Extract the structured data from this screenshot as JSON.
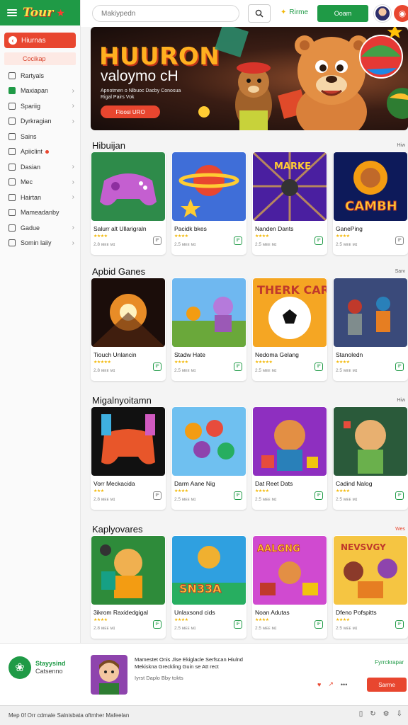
{
  "brand": {
    "logo": "Tour"
  },
  "sidebar": {
    "active": "Hiurnas",
    "sub": "Cocikap",
    "items": [
      {
        "label": "Rartyals",
        "chevron": false,
        "green": false,
        "dot": false
      },
      {
        "label": "Maxiapan",
        "chevron": true,
        "green": true,
        "dot": false
      },
      {
        "label": "Spariig",
        "chevron": true,
        "green": false,
        "dot": false
      },
      {
        "label": "Dyrkragian",
        "chevron": true,
        "green": false,
        "dot": false
      },
      {
        "label": "Sains",
        "chevron": false,
        "green": false,
        "dot": false
      },
      {
        "label": "Apiiclint",
        "chevron": false,
        "green": false,
        "dot": true
      },
      {
        "label": "Dasian",
        "chevron": true,
        "green": false,
        "dot": false
      },
      {
        "label": "Mec",
        "chevron": true,
        "green": false,
        "dot": false
      },
      {
        "label": "Hairtan",
        "chevron": true,
        "green": false,
        "dot": false
      },
      {
        "label": "Mameadanby",
        "chevron": false,
        "green": false,
        "dot": false
      },
      {
        "label": "Gadue",
        "chevron": true,
        "green": false,
        "dot": false
      },
      {
        "label": "Somin laiiy",
        "chevron": true,
        "green": false,
        "dot": false
      }
    ]
  },
  "header": {
    "search_placeholder": "Makiypedn",
    "promo": "Rirme",
    "cta": "Ooam"
  },
  "hero": {
    "title": "HUURON",
    "subtitle": "valoymo cH",
    "desc": "Apnotmen o Nlbuoc Dacby Conosua Rigal Pairs Vok",
    "button": "Floosi URO"
  },
  "sections": [
    {
      "title": "Hibuijan",
      "more": "Hiw",
      "more_red": false,
      "cards": [
        {
          "title": "Salurr alt Ullarigraln",
          "stars": "★★★★",
          "meta": "2.8 ᴍᴇᴇ ᴍɪ",
          "badge": "IF",
          "badge_gray": true
        },
        {
          "title": "Pacidk bkes",
          "stars": "★★★★",
          "meta": "2.5 ᴍᴇᴇ ᴍɪ",
          "badge": "IF",
          "badge_gray": false
        },
        {
          "title": "Nanden Dants",
          "stars": "★★★★",
          "meta": "2.5 ᴍᴇᴇ ᴍɪ",
          "badge": "IF",
          "badge_gray": false
        },
        {
          "title": "GanePing",
          "stars": "★★★★",
          "meta": "2.5 ᴍᴇᴇ ᴍɪ",
          "badge": "IF",
          "badge_gray": true
        }
      ]
    },
    {
      "title": "Apbid Ganes",
      "more": "Sarv",
      "more_red": false,
      "cards": [
        {
          "title": "Tiouch Unlancin",
          "stars": "★★★★★",
          "meta": "2.8 ᴍᴇᴇ ᴍɪ",
          "badge": "IF",
          "badge_gray": false
        },
        {
          "title": "Stadw Hate",
          "stars": "★★★★",
          "meta": "2.5 ᴍᴇᴇ ᴍɪ",
          "badge": "IF",
          "badge_gray": false
        },
        {
          "title": "Nedoma Gelang",
          "stars": "★★★★★",
          "meta": "2.5 ᴍᴇᴇ ᴍɪ",
          "badge": "IF",
          "badge_gray": false
        },
        {
          "title": "Stanoledn",
          "stars": "★★★★",
          "meta": "2.5 ᴍᴇᴇ ᴍɪ",
          "badge": "IF",
          "badge_gray": false
        }
      ]
    },
    {
      "title": "Migalnyoitamn",
      "more": "Hiw",
      "more_red": false,
      "cards": [
        {
          "title": "Vorr Meckacida",
          "stars": "★★★",
          "meta": "2.8 ᴍᴇᴇ ᴍɪ",
          "badge": "IF",
          "badge_gray": true
        },
        {
          "title": "Darm Aane Nig",
          "stars": "★★★★",
          "meta": "2.5 ᴍᴇᴇ ᴍɪ",
          "badge": "IF",
          "badge_gray": false
        },
        {
          "title": "Dat Reet Dats",
          "stars": "★★★★",
          "meta": "2.5 ᴍᴇᴇ ᴍɪ",
          "badge": "IF",
          "badge_gray": false
        },
        {
          "title": "Cadind Nalog",
          "stars": "★★★★",
          "meta": "2.5 ᴍᴇᴇ ᴍɪ",
          "badge": "IF",
          "badge_gray": false
        }
      ]
    },
    {
      "title": "Kaplyovares",
      "more": "Wes",
      "more_red": true,
      "cards": [
        {
          "title": "3ikrom Raxidedgigal",
          "stars": "★★★★",
          "meta": "2.8 ᴍᴇᴇ ᴍɪ",
          "badge": "IF",
          "badge_gray": false
        },
        {
          "title": "Unlaxsond cids",
          "stars": "★★★★",
          "meta": "2.5 ᴍᴇᴇ ᴍɪ",
          "badge": "IF",
          "badge_gray": false
        },
        {
          "title": "Noan Adutas",
          "stars": "★★★★",
          "meta": "2.5 ᴍᴇᴇ ᴍɪ",
          "badge": "IF",
          "badge_gray": false
        },
        {
          "title": "Dfeno Pofspitts",
          "stars": "★★★★",
          "meta": "2.5 ᴍᴇᴇ ᴍɪ",
          "badge": "IF",
          "badge_gray": false
        }
      ]
    }
  ],
  "footer": {
    "brand_title": "Stayysind",
    "brand_sub": "Catsenno",
    "text": "Mamestet Onis Jlse Ekiglacle Serfscan Hiulnd Mekiskna Greckling Guin se Att rect",
    "small": "Iyrst Daplo Bby tokts",
    "right": "Fyrrckrapar",
    "button": "Sarme"
  },
  "bottombar": {
    "text": "Mep 0f Orr cdmale Salnisbata oftmher Mafeelan"
  },
  "colors": {
    "accent_green": "#1f9a46",
    "accent_red": "#e8462f",
    "star": "#f2b705"
  }
}
